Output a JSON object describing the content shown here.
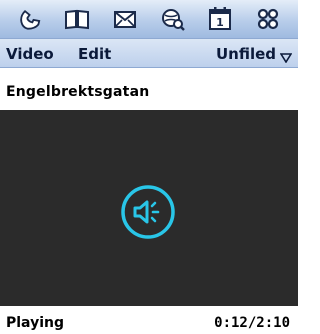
{
  "launcher": {
    "apps": [
      {
        "icon": "phone-icon"
      },
      {
        "icon": "address-book-icon"
      },
      {
        "icon": "mail-icon"
      },
      {
        "icon": "web-browser-icon"
      },
      {
        "icon": "calendar-icon"
      },
      {
        "icon": "app-grid-icon"
      }
    ],
    "calendar_day": "1"
  },
  "menubar": {
    "video_label": "Video",
    "edit_label": "Edit",
    "category_label": "Unfiled"
  },
  "clip": {
    "title": "Engelbrektsgatan"
  },
  "player": {
    "icon": "speaker-icon",
    "accent_color": "#29c6e8",
    "background_color": "#2b2b2b"
  },
  "status": {
    "state": "Playing",
    "time": "0:12/2:10"
  }
}
